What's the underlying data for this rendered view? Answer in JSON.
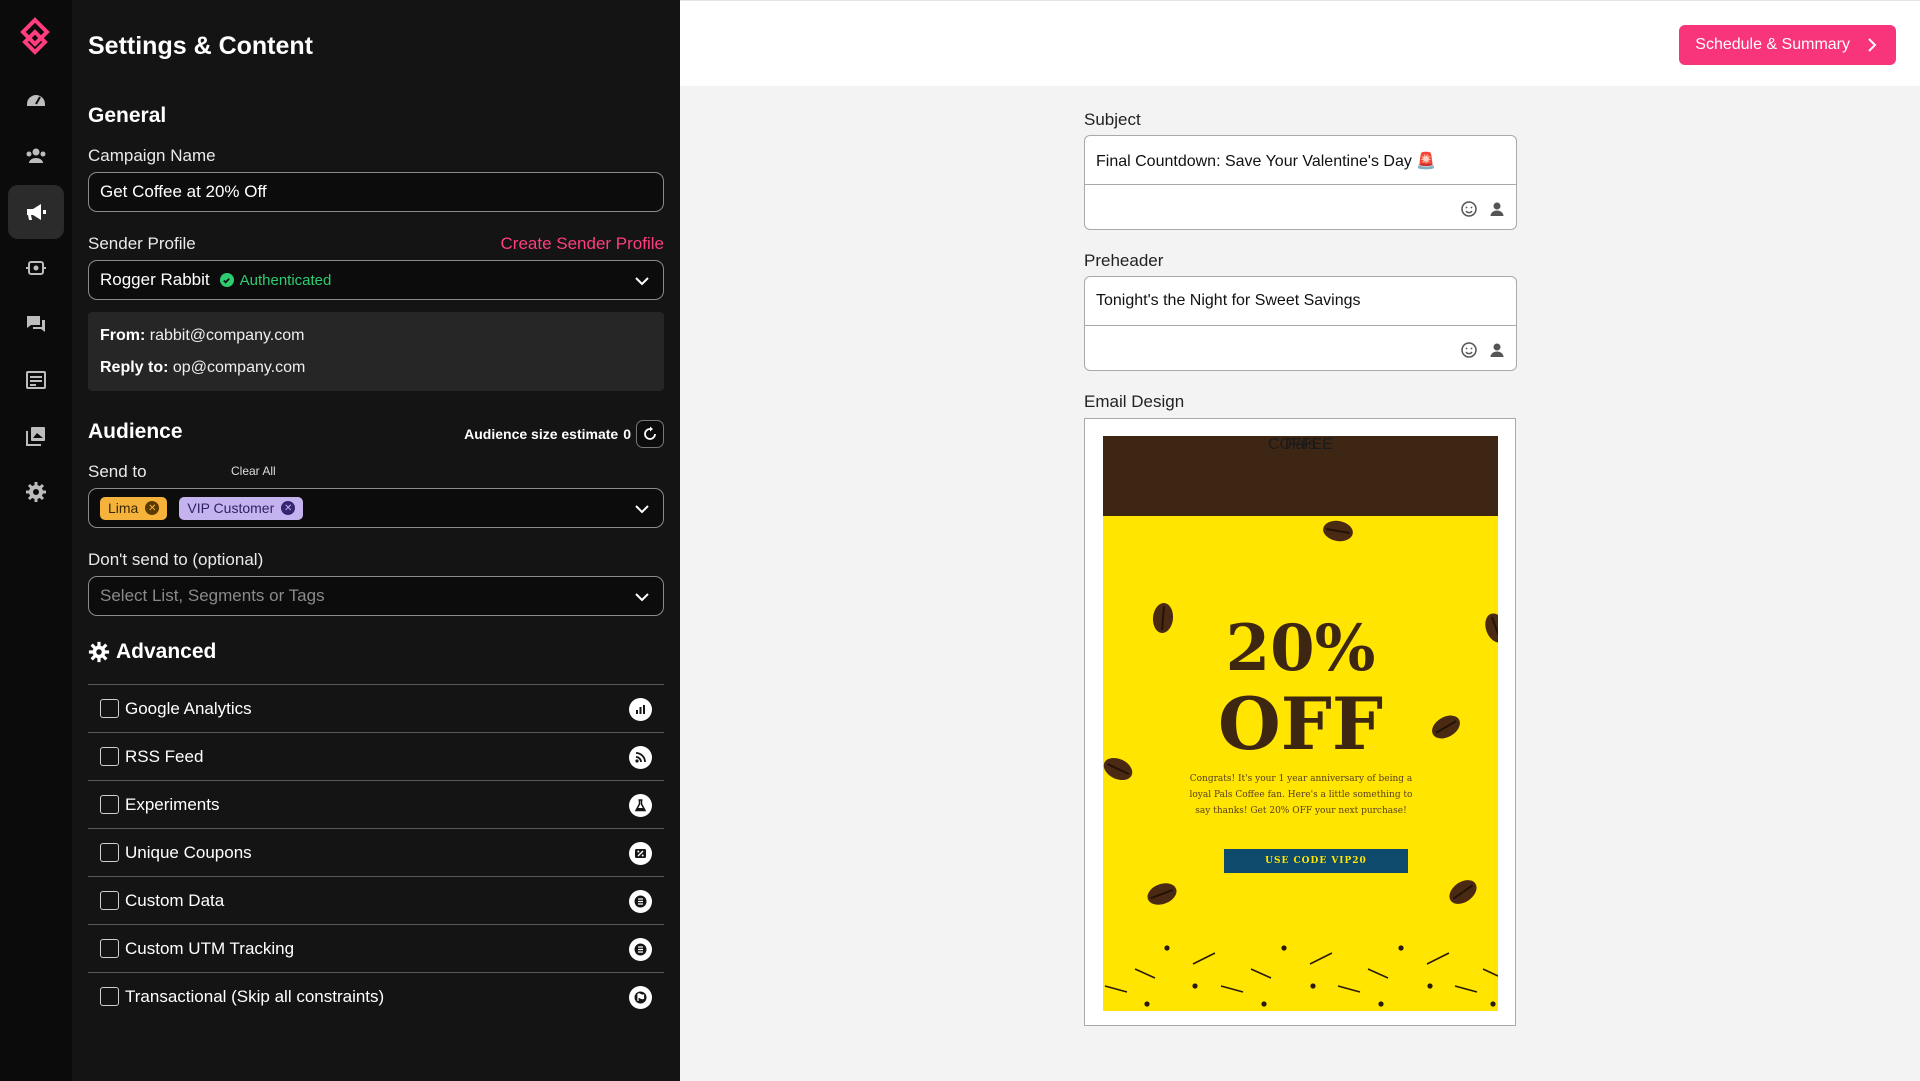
{
  "rail": {
    "items": [
      "dashboard",
      "contacts",
      "campaigns",
      "automation",
      "messages",
      "forms",
      "media",
      "settings"
    ],
    "active": "campaigns"
  },
  "panel": {
    "title": "Settings & Content",
    "general": {
      "title": "General",
      "campaign_name_label": "Campaign Name",
      "campaign_name_value": "Get Coffee at 20% Off",
      "sender_profile_label": "Sender Profile",
      "create_sender_link": "Create Sender Profile",
      "sender_name": "Rogger Rabbit",
      "sender_status": "Authenticated",
      "from_label": "From:",
      "from_value": "rabbit@company.com",
      "reply_label": "Reply to:",
      "reply_value": "op@company.com"
    },
    "audience": {
      "title": "Audience",
      "estimate_label": "Audience size estimate",
      "estimate_value": "0",
      "send_to_label": "Send to",
      "clear_all": "Clear All",
      "send_to_tags": [
        {
          "label": "Lima",
          "color": "#f6b33c"
        },
        {
          "label": "VIP Customer",
          "color": "#c5b3f0"
        }
      ],
      "dont_send_label": "Don't send to (optional)",
      "dont_send_placeholder": "Select List, Segments or Tags"
    },
    "advanced": {
      "title": "Advanced",
      "items": [
        {
          "label": "Google Analytics",
          "checked": false,
          "icon": "bar-chart-icon"
        },
        {
          "label": "RSS Feed",
          "checked": false,
          "icon": "rss-icon"
        },
        {
          "label": "Experiments",
          "checked": false,
          "icon": "flask-icon"
        },
        {
          "label": "Unique Coupons",
          "checked": false,
          "icon": "coupon-icon"
        },
        {
          "label": "Custom Data",
          "checked": false,
          "icon": "list-icon"
        },
        {
          "label": "Custom UTM Tracking",
          "checked": false,
          "icon": "list-icon"
        },
        {
          "label": "Transactional (Skip all constraints)",
          "checked": false,
          "icon": "flag-icon"
        }
      ]
    }
  },
  "header": {
    "cta_label": "Schedule & Summary"
  },
  "content": {
    "subject_label": "Subject",
    "subject_value": "Final Countdown: Save Your Valentine's Day 🚨",
    "preheader_label": "Preheader",
    "preheader_value": "Tonight's the Night for Sweet Savings",
    "design_label": "Email Design",
    "email": {
      "brand_name": "Pals",
      "brand_sub": "COFFEE",
      "headline_1": "20%",
      "headline_2": "OFF",
      "body": "Congrats! It's your 1 year anniversary of being a loyal Pals Coffee fan. Here's a little something to say thanks! Get 20% OFF your next purchase!",
      "button_label": "USE CODE VIP20"
    }
  },
  "colors": {
    "accent": "#f8347a",
    "panel_bg": "#141414",
    "success": "#2ecc71",
    "email_bg": "#ffe500",
    "email_header": "#3e2614"
  }
}
